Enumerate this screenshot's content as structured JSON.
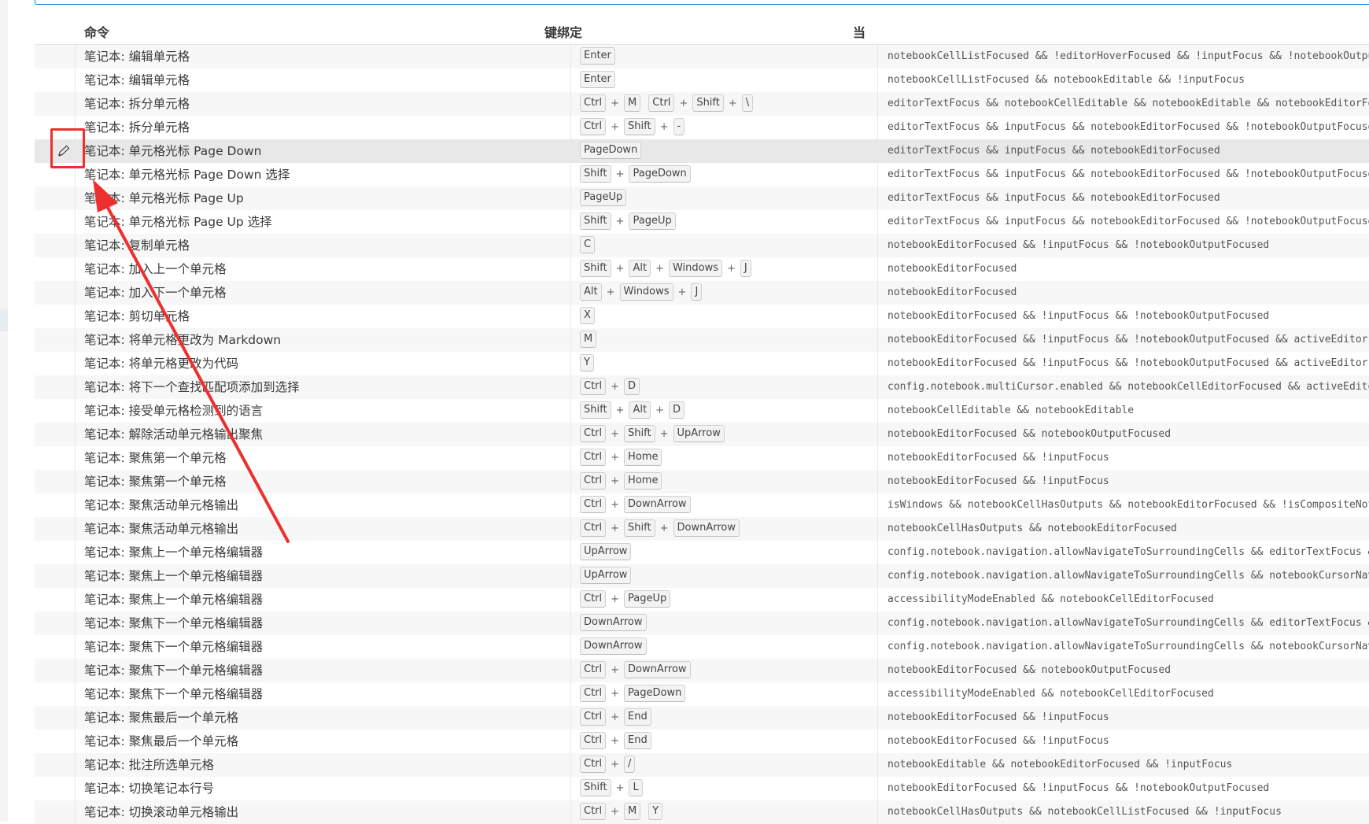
{
  "header": {
    "command": "命令",
    "keybinding": "键绑定",
    "when": "当"
  },
  "rows": [
    {
      "cmd": "笔记本: 编辑单元格",
      "keys": [
        [
          "Enter"
        ]
      ],
      "when": "notebookCellListFocused && !editorHoverFocused && !inputFocus && !notebookOutputI"
    },
    {
      "cmd": "笔记本: 编辑单元格",
      "keys": [
        [
          "Enter"
        ]
      ],
      "when": "notebookCellListFocused && notebookEditable && !inputFocus"
    },
    {
      "cmd": "笔记本: 拆分单元格",
      "keys": [
        [
          "Ctrl",
          "M"
        ],
        [
          "Ctrl",
          "Shift",
          "\\"
        ]
      ],
      "when": "editorTextFocus && notebookCellEditable && notebookEditable && notebookEditorFocu"
    },
    {
      "cmd": "笔记本: 拆分单元格",
      "keys": [
        [
          "Ctrl",
          "Shift",
          "-"
        ]
      ],
      "when": "editorTextFocus && inputFocus && notebookEditorFocused && !notebookOutputFocused"
    },
    {
      "cmd": "笔记本: 单元格光标 Page Down",
      "keys": [
        [
          "PageDown"
        ]
      ],
      "when": "editorTextFocus && inputFocus && notebookEditorFocused",
      "selected": true
    },
    {
      "cmd": "笔记本: 单元格光标 Page Down 选择",
      "keys": [
        [
          "Shift",
          "PageDown"
        ]
      ],
      "when": "editorTextFocus && inputFocus && notebookEditorFocused && !notebookOutputFocused"
    },
    {
      "cmd": "笔记本: 单元格光标 Page Up",
      "keys": [
        [
          "PageUp"
        ]
      ],
      "when": "editorTextFocus && inputFocus && notebookEditorFocused"
    },
    {
      "cmd": "笔记本: 单元格光标 Page Up 选择",
      "keys": [
        [
          "Shift",
          "PageUp"
        ]
      ],
      "when": "editorTextFocus && inputFocus && notebookEditorFocused && !notebookOutputFocused"
    },
    {
      "cmd": "笔记本: 复制单元格",
      "keys": [
        [
          "C"
        ]
      ],
      "when": "notebookEditorFocused && !inputFocus && !notebookOutputFocused"
    },
    {
      "cmd": "笔记本: 加入上一个单元格",
      "keys": [
        [
          "Shift",
          "Alt",
          "Windows",
          "J"
        ]
      ],
      "when": "notebookEditorFocused"
    },
    {
      "cmd": "笔记本: 加入下一个单元格",
      "keys": [
        [
          "Alt",
          "Windows",
          "J"
        ]
      ],
      "when": "notebookEditorFocused"
    },
    {
      "cmd": "笔记本: 剪切单元格",
      "keys": [
        [
          "X"
        ]
      ],
      "when": "notebookEditorFocused && !inputFocus && !notebookOutputFocused"
    },
    {
      "cmd": "笔记本: 将单元格更改为 Markdown",
      "keys": [
        [
          "M"
        ]
      ],
      "when": "notebookEditorFocused && !inputFocus && !notebookOutputFocused && activeEditor =="
    },
    {
      "cmd": "笔记本: 将单元格更改为代码",
      "keys": [
        [
          "Y"
        ]
      ],
      "when": "notebookEditorFocused && !inputFocus && !notebookOutputFocused && activeEditor =="
    },
    {
      "cmd": "笔记本: 将下一个查找匹配项添加到选择",
      "keys": [
        [
          "Ctrl",
          "D"
        ]
      ],
      "when": "config.notebook.multiCursor.enabled && notebookCellEditorFocused && activeEditor"
    },
    {
      "cmd": "笔记本: 接受单元格检测到的语言",
      "keys": [
        [
          "Shift",
          "Alt",
          "D"
        ]
      ],
      "when": "notebookCellEditable && notebookEditable"
    },
    {
      "cmd": "笔记本: 解除活动单元格输出聚焦",
      "keys": [
        [
          "Ctrl",
          "Shift",
          "UpArrow"
        ]
      ],
      "when": "notebookEditorFocused && notebookOutputFocused"
    },
    {
      "cmd": "笔记本: 聚焦第一个单元格",
      "keys": [
        [
          "Ctrl",
          "Home"
        ]
      ],
      "when": "notebookEditorFocused && !inputFocus"
    },
    {
      "cmd": "笔记本: 聚焦第一个单元格",
      "keys": [
        [
          "Ctrl",
          "Home"
        ]
      ],
      "when": "notebookEditorFocused && !inputFocus"
    },
    {
      "cmd": "笔记本: 聚焦活动单元格输出",
      "keys": [
        [
          "Ctrl",
          "DownArrow"
        ]
      ],
      "when": "isWindows && notebookCellHasOutputs && notebookEditorFocused && !isCompositeNotebo"
    },
    {
      "cmd": "笔记本: 聚焦活动单元格输出",
      "keys": [
        [
          "Ctrl",
          "Shift",
          "DownArrow"
        ]
      ],
      "when": "notebookCellHasOutputs && notebookEditorFocused"
    },
    {
      "cmd": "笔记本: 聚焦上一个单元格编辑器",
      "keys": [
        [
          "UpArrow"
        ]
      ],
      "when": "config.notebook.navigation.allowNavigateToSurroundingCells && editorTextFocus &&"
    },
    {
      "cmd": "笔记本: 聚焦上一个单元格编辑器",
      "keys": [
        [
          "UpArrow"
        ]
      ],
      "when": "config.notebook.navigation.allowNavigateToSurroundingCells && notebookCursorNavig"
    },
    {
      "cmd": "笔记本: 聚焦上一个单元格编辑器",
      "keys": [
        [
          "Ctrl",
          "PageUp"
        ]
      ],
      "when": "accessibilityModeEnabled && notebookCellEditorFocused"
    },
    {
      "cmd": "笔记本: 聚焦下一个单元格编辑器",
      "keys": [
        [
          "DownArrow"
        ]
      ],
      "when": "config.notebook.navigation.allowNavigateToSurroundingCells && editorTextFocus &&"
    },
    {
      "cmd": "笔记本: 聚焦下一个单元格编辑器",
      "keys": [
        [
          "DownArrow"
        ]
      ],
      "when": "config.notebook.navigation.allowNavigateToSurroundingCells && notebookCursorNavig"
    },
    {
      "cmd": "笔记本: 聚焦下一个单元格编辑器",
      "keys": [
        [
          "Ctrl",
          "DownArrow"
        ]
      ],
      "when": "notebookEditorFocused && notebookOutputFocused"
    },
    {
      "cmd": "笔记本: 聚焦下一个单元格编辑器",
      "keys": [
        [
          "Ctrl",
          "PageDown"
        ]
      ],
      "when": "accessibilityModeEnabled && notebookCellEditorFocused"
    },
    {
      "cmd": "笔记本: 聚焦最后一个单元格",
      "keys": [
        [
          "Ctrl",
          "End"
        ]
      ],
      "when": "notebookEditorFocused && !inputFocus"
    },
    {
      "cmd": "笔记本: 聚焦最后一个单元格",
      "keys": [
        [
          "Ctrl",
          "End"
        ]
      ],
      "when": "notebookEditorFocused && !inputFocus"
    },
    {
      "cmd": "笔记本: 批注所选单元格",
      "keys": [
        [
          "Ctrl",
          "/"
        ]
      ],
      "when": "notebookEditable && notebookEditorFocused && !inputFocus"
    },
    {
      "cmd": "笔记本: 切换笔记本行号",
      "keys": [
        [
          "Shift",
          "L"
        ]
      ],
      "when": "notebookEditorFocused && !inputFocus && !notebookOutputFocused"
    },
    {
      "cmd": "笔记本: 切换滚动单元格输出",
      "keys": [
        [
          "Ctrl",
          "M"
        ],
        [
          "Y"
        ]
      ],
      "when": "notebookCellHasOutputs && notebookCellListFocused && !inputFocus"
    }
  ],
  "icons": {
    "edit": "pencil-icon"
  },
  "colors": {
    "annotation": "#ee2f2f",
    "selected_row": "#e8e8e8",
    "focus_border": "#0078d4"
  }
}
